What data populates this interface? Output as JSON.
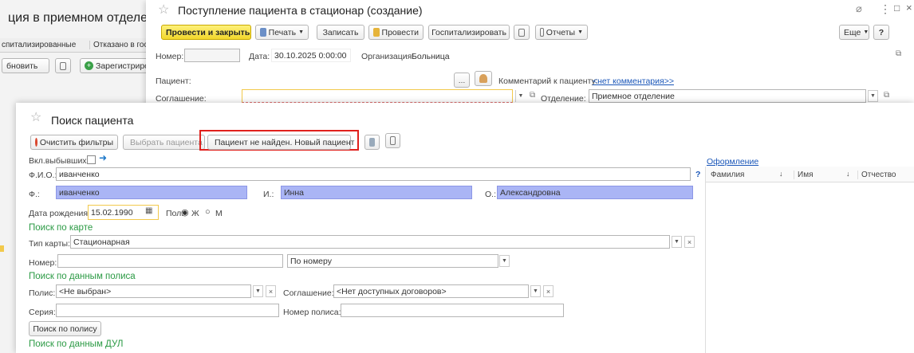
{
  "bg_window": {
    "title": "ция в приемном отделе",
    "tabs": [
      "спитализированные",
      "Отказано в гос"
    ],
    "update_btn": "бновить",
    "register_btn": "Зарегистриров"
  },
  "admit": {
    "title": "Поступление пациента в стационар (создание)",
    "toolbar": {
      "post_close": "Провести и закрыть",
      "print": "Печать",
      "save": "Записать",
      "post": "Провести",
      "hospitalize": "Госпитализировать",
      "reports": "Отчеты",
      "more": "Еще",
      "help": "?"
    },
    "number_label": "Номер:",
    "number_value": "",
    "date_label": "Дата:",
    "date_value": "30.10.2025 0:00:00",
    "org_label": "Организация:",
    "org_value": "Больница",
    "patient_label": "Пациент:",
    "comment_label": "Комментарий к пациенту:",
    "comment_link": "<нет комментария>>",
    "agreement_label": "Соглашение:",
    "agreement_value": "",
    "dept_label": "Отделение:",
    "dept_value": "Приемное отделение"
  },
  "search": {
    "title": "Поиск пациента",
    "toolbar": {
      "clear_filters": "Очистить фильтры",
      "select_patient": "Выбрать пациента",
      "not_found": "Пациент не найден. Новый пациент"
    },
    "include_retired_label": "Вкл.выбывших:",
    "fio_label": "Ф.И.О.:",
    "fio_value": "иванченко",
    "help": "?",
    "f_label": "Ф.:",
    "f_value": "иванченко",
    "i_label": "И.:",
    "i_value": "Инна",
    "o_label": "О.:",
    "o_value": "Александровна",
    "dob_label": "Дата рождения:",
    "dob_value": "15.02.1990",
    "sex_label": "Пол:",
    "sex_f": "Ж",
    "sex_m": "М",
    "card_section": "Поиск по карте",
    "card_type_label": "Тип карты:",
    "card_type_value": "Стационарная",
    "card_number_label": "Номер:",
    "card_number_value": "",
    "by_number_value": "По номеру",
    "policy_section": "Поиск по данным полиса",
    "policy_label": "Полис:",
    "policy_value": "<Не выбран>",
    "agreement_label": "Соглашение:",
    "agreement_value": "<Нет доступных договоров>",
    "series_label": "Серия:",
    "series_value": "",
    "policy_number_label": "Номер полиса:",
    "policy_number_value": "",
    "policy_search_btn": "Поиск по полису",
    "dul_section": "Поиск по данным ДУЛ",
    "design_link": "Оформление",
    "results_columns": [
      "Фамилия",
      "Имя",
      "Отчество"
    ]
  },
  "colors": {
    "accent_green": "#2b9a44",
    "highlight_red": "#e0201c",
    "blue_field": "#aab5f5",
    "link": "#1a56b8"
  }
}
